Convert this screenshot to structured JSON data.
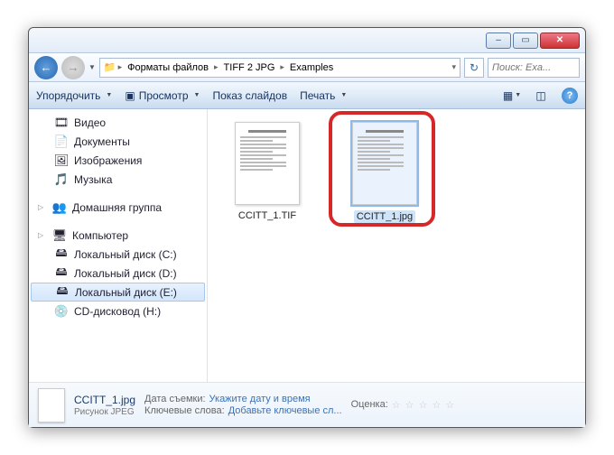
{
  "titlebar": {
    "min": "–",
    "max": "▭",
    "close": "✕"
  },
  "breadcrumb": {
    "segs": [
      "Форматы файлов",
      "TIFF 2 JPG",
      "Examples"
    ],
    "search_placeholder": "Поиск: Exa..."
  },
  "toolbar": {
    "organize": "Упорядочить",
    "preview": "Просмотр",
    "slideshow": "Показ слайдов",
    "print": "Печать"
  },
  "sidebar": {
    "libs": [
      {
        "icon": "🎞",
        "label": "Видео"
      },
      {
        "icon": "📄",
        "label": "Документы"
      },
      {
        "icon": "🖼",
        "label": "Изображения"
      },
      {
        "icon": "🎵",
        "label": "Музыка"
      }
    ],
    "homegroup": {
      "icon": "👥",
      "label": "Домашняя группа"
    },
    "computer": {
      "icon": "🖥",
      "label": "Компьютер"
    },
    "drives": [
      {
        "icon": "🖴",
        "label": "Локальный диск (C:)"
      },
      {
        "icon": "🖴",
        "label": "Локальный диск (D:)"
      },
      {
        "icon": "🖴",
        "label": "Локальный диск (E:)",
        "selected": true
      },
      {
        "icon": "💿",
        "label": "CD-дисковод (H:)"
      }
    ]
  },
  "files": [
    {
      "name": "CCITT_1.TIF",
      "selected": false
    },
    {
      "name": "CCITT_1.jpg",
      "selected": true
    }
  ],
  "details": {
    "filename": "CCITT_1.jpg",
    "type": "Рисунок JPEG",
    "date_k": "Дата съемки:",
    "date_v": "Укажите дату и время",
    "keywords_k": "Ключевые слова:",
    "keywords_v": "Добавьте ключевые сл...",
    "rating_k": "Оценка:",
    "stars": "☆ ☆ ☆ ☆ ☆"
  }
}
